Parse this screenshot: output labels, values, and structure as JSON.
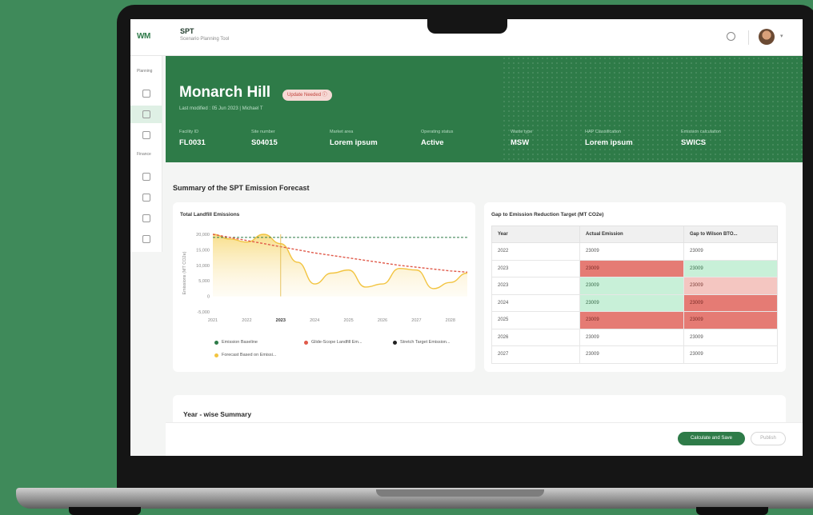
{
  "app": {
    "logo_text": "WM",
    "title": "SPT",
    "subtitle": "Scenario Planning Tool"
  },
  "sidebar": {
    "planning_label": "Planning",
    "finance_label": "Finance"
  },
  "hero": {
    "site_name": "Monarch Hill",
    "badge": "Update Needed",
    "modified": "Last modified : 05 Jun 2023 | Michael T",
    "meta": [
      {
        "label": "Facility ID",
        "value": "FL0031"
      },
      {
        "label": "Site number",
        "value": "S04015"
      },
      {
        "label": "Market area",
        "value": "Lorem ipsum"
      },
      {
        "label": "Operating status",
        "value": "Active"
      },
      {
        "label": "Waste type",
        "value": "MSW"
      },
      {
        "label": "HAP Classification",
        "value": "Lorem ipsum"
      },
      {
        "label": "Emission calculation",
        "value": "SWICS"
      }
    ]
  },
  "summary_title": "Summary of the SPT Emission Forecast",
  "chart_data": {
    "type": "area",
    "title": "Total Landfill Emissions",
    "ylabel": "Emissions (MT CO2e)",
    "ytick_labels": [
      "20,000",
      "15,000",
      "10,000",
      "5,000",
      "0",
      "-5,000"
    ],
    "y_ticks": [
      20000,
      15000,
      10000,
      5000,
      0,
      -5000
    ],
    "ylim": [
      -5000,
      20000
    ],
    "x_tick_labels": [
      "2021",
      "2022",
      "2023",
      "2024",
      "2025",
      "2026",
      "2027",
      "2028"
    ],
    "x": [
      2021,
      2021.5,
      2022,
      2022.5,
      2023,
      2023.5,
      2024,
      2024.5,
      2025,
      2025.5,
      2026,
      2026.5,
      2027,
      2027.5,
      2028,
      2028.5
    ],
    "series": [
      {
        "name": "Forecast Based on Emission",
        "color": "#f2c440",
        "values": [
          20000,
          18500,
          17500,
          20000,
          17000,
          11000,
          4000,
          7500,
          8500,
          3000,
          4000,
          9000,
          8500,
          2500,
          4500,
          7500
        ]
      },
      {
        "name": "Emission Baseline",
        "color": "#2e7b48",
        "values": [
          19000,
          19000,
          19000,
          19000,
          19000,
          19000,
          19000,
          19000,
          19000,
          19000,
          19000,
          19000,
          19000,
          19000,
          19000,
          19000
        ]
      },
      {
        "name": "Glide-Scope Landfill Emission",
        "color": "#e05a4a",
        "values": [
          20000,
          19000,
          18000,
          17000,
          16000,
          15000,
          14000,
          13200,
          12400,
          11600,
          10800,
          10000,
          9400,
          8800,
          8200,
          7800
        ]
      }
    ],
    "marker_x": 2023,
    "grid": false,
    "legend": [
      {
        "label": "Emission Baseline",
        "color": "#2e7b48"
      },
      {
        "label": "Glide-Scope Landfill Em...",
        "color": "#e05a4a"
      },
      {
        "label": "Stretch Target Emission...",
        "color": "#222222"
      },
      {
        "label": "Forecast Based on Emissi...",
        "color": "#f2c440"
      }
    ]
  },
  "gap_table": {
    "title": "Gap to Emission Reduction Target (MT CO2e)",
    "headers": [
      "Year",
      "Actual Emission",
      "Gap to Wilson BTO..."
    ],
    "rows": [
      [
        "2022",
        "23009",
        "23009"
      ],
      [
        "2023",
        "23009",
        "23009"
      ],
      [
        "2023",
        "23009",
        "23009"
      ],
      [
        "2024",
        "23009",
        "23009"
      ],
      [
        "2025",
        "23009",
        "23009"
      ],
      [
        "2026",
        "23009",
        "23009"
      ],
      [
        "2027",
        "23009",
        "23009"
      ]
    ],
    "cell_status": [
      [
        "",
        ""
      ],
      [
        "red",
        "green"
      ],
      [
        "green",
        "pink"
      ],
      [
        "green",
        "red"
      ],
      [
        "red",
        "red"
      ],
      [
        "",
        ""
      ],
      [
        "",
        ""
      ]
    ]
  },
  "year_wise_title": "Year - wise Summary",
  "actions": {
    "save": "Calculate and Save",
    "publish": "Publish"
  }
}
